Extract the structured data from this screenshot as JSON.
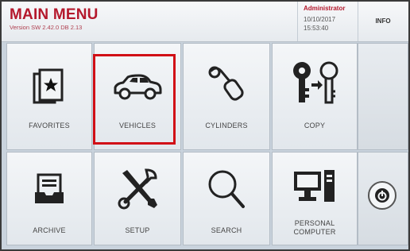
{
  "header": {
    "title": "MAIN MENU",
    "version": "Version SW 2.42.0 DB 2.13",
    "user": "Administrator",
    "date": "10/10/2017",
    "time": "15:53:40",
    "info_label": "INFO"
  },
  "tiles": [
    {
      "label": "FAVORITES",
      "icon": "favorites-card-star-icon"
    },
    {
      "label": "VEHICLES",
      "icon": "car-icon"
    },
    {
      "label": "CYLINDERS",
      "icon": "key-cylinder-icon"
    },
    {
      "label": "COPY",
      "icon": "copy-keys-icon"
    },
    {
      "label": "ARCHIVE",
      "icon": "archive-tray-icon"
    },
    {
      "label": "SETUP",
      "icon": "tools-icon"
    },
    {
      "label": "SEARCH",
      "icon": "magnifier-icon"
    },
    {
      "label": "PERSONAL",
      "label2": "COMPUTER",
      "icon": "computer-icon"
    }
  ],
  "side": {
    "power_icon": "power-icon"
  },
  "colors": {
    "accent": "#b4182c",
    "highlight": "#d10f16",
    "tile_bg": "#eef1f4"
  }
}
